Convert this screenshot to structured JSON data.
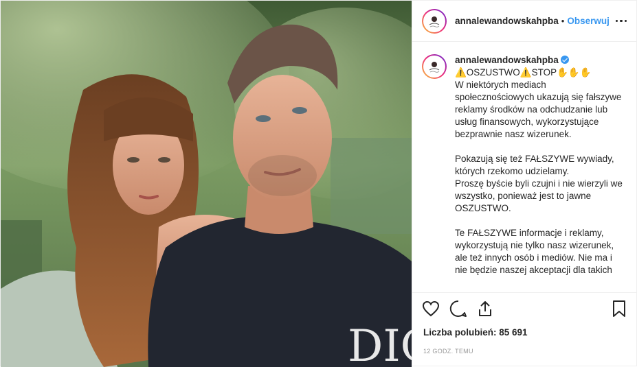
{
  "post": {
    "username": "annalewandowskahpba",
    "separator": "•",
    "follow_label": "Obserwuj",
    "caption": {
      "username": "annalewandowskahpba",
      "first_line": "⚠️OSZUSTWO⚠️STOP✋✋✋",
      "paragraphs": [
        "W niektórych mediach społecznościowych ukazują się fałszywe reklamy środków na odchudzanie lub usług finansowych, wykorzystujące bezprawnie nasz wizerunek.",
        "Pokazują się też FAŁSZYWE wywiady, których rzekomo udzielamy.\nProszę byście byli czujni i nie wierzyli we wszystko, ponieważ jest to jawne OSZUSTWO.",
        "Te FAŁSZYWE informacje i reklamy, wykorzystują nie tylko nasz wizerunek, ale też innych osób i mediów. Nie ma i nie będzie naszej akceptacji dla takich"
      ]
    },
    "likes_label": "Liczba polubień: 85 691",
    "timestamp": "12 GODZ. TEMU",
    "photo_text": "DIO"
  },
  "colors": {
    "follow": "#3897f0",
    "verified": "#3897f0",
    "timestamp": "#999999"
  },
  "icons": [
    "more-options-icon",
    "like-heart-icon",
    "comment-icon",
    "share-icon",
    "save-bookmark-icon",
    "verified-badge-icon"
  ]
}
